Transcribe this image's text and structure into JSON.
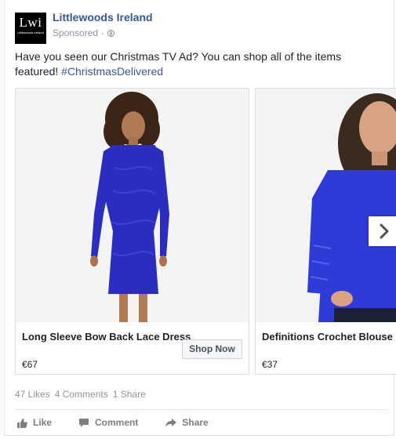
{
  "page": {
    "logo_text": "Lwi",
    "logo_subtext": "Littlewoods Ireland",
    "name": "Littlewoods Ireland",
    "sponsored": "Sponsored",
    "sponsored_sep": "·"
  },
  "post": {
    "text": "Have you seen our Christmas TV Ad? You can shop all of the items featured! ",
    "hashtag": "#ChristmasDelivered"
  },
  "carousel": {
    "items": [
      {
        "title": "Long Sleeve Bow Back Lace Dress",
        "price": "€67",
        "cta": "Shop Now"
      },
      {
        "title": "Definitions Crochet Blouse",
        "price": "€37"
      }
    ]
  },
  "stats": {
    "likes": "47 Likes",
    "comments": "4 Comments",
    "shares": "1 Share"
  },
  "actions": {
    "like": "Like",
    "comment": "Comment",
    "share": "Share"
  },
  "colors": {
    "link": "#365899",
    "dress": "#2b2cc0",
    "blouse": "#2e3bd8"
  }
}
